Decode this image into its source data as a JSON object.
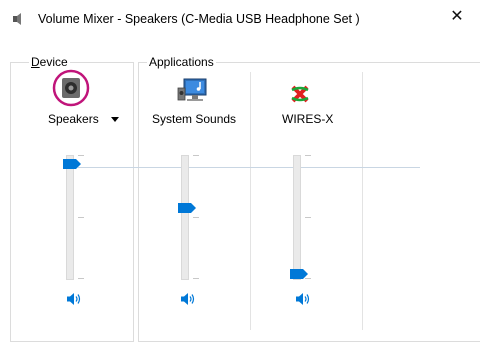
{
  "window": {
    "title": "Volume Mixer - Speakers (C-Media USB Headphone Set )",
    "close_glyph": "✕"
  },
  "device": {
    "group_label_prefix": "",
    "group_label_underline": "D",
    "group_label_rest": "evice",
    "name": "Speakers",
    "icon": "speaker-icon",
    "level": 0.93,
    "mute_icon": "speaker-volume-icon"
  },
  "applications": {
    "group_label": "Applications",
    "items": [
      {
        "name": "System Sounds",
        "icon": "system-sounds-icon",
        "level": 0.57,
        "mute_icon": "speaker-volume-icon"
      },
      {
        "name": "WIRES-X",
        "icon": "wires-x-icon",
        "level": 0.03,
        "mute_icon": "speaker-volume-icon"
      }
    ]
  },
  "colors": {
    "accent": "#0078d7",
    "device_highlight": "#c0147a",
    "track": "#eaeaea"
  }
}
